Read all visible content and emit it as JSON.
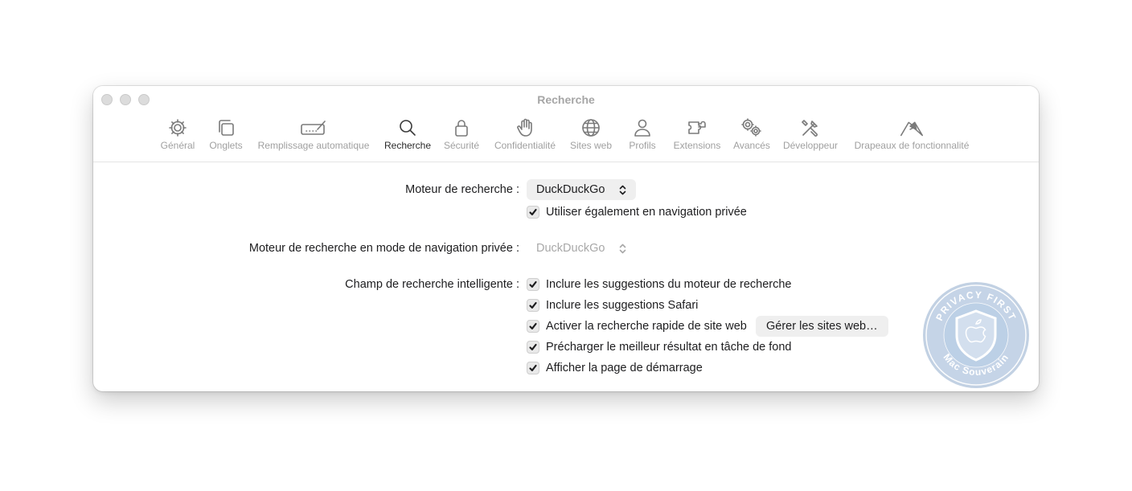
{
  "window": {
    "title": "Recherche"
  },
  "toolbar": {
    "items": [
      {
        "label": "Général",
        "icon": "gear-icon"
      },
      {
        "label": "Onglets",
        "icon": "tabs-icon"
      },
      {
        "label": "Remplissage automatique",
        "icon": "autofill-icon"
      },
      {
        "label": "Recherche",
        "icon": "search-icon",
        "active": true
      },
      {
        "label": "Sécurité",
        "icon": "lock-icon"
      },
      {
        "label": "Confidentialité",
        "icon": "hand-icon"
      },
      {
        "label": "Sites web",
        "icon": "globe-icon"
      },
      {
        "label": "Profils",
        "icon": "person-icon"
      },
      {
        "label": "Extensions",
        "icon": "puzzle-icon"
      },
      {
        "label": "Avancés",
        "icon": "gears-icon"
      },
      {
        "label": "Développeur",
        "icon": "tools-icon"
      },
      {
        "label": "Drapeaux de fonctionnalité",
        "icon": "flags-icon"
      }
    ]
  },
  "search": {
    "engine_label": "Moteur de recherche :",
    "engine_value": "DuckDuckGo",
    "private_also_label": "Utiliser également en navigation privée",
    "private_engine_label": "Moteur de recherche en mode de navigation privée :",
    "private_engine_value": "DuckDuckGo",
    "smart_field_label": "Champ de recherche intelligente :",
    "options": [
      {
        "label": "Inclure les suggestions du moteur de recherche",
        "checked": true
      },
      {
        "label": "Inclure les suggestions Safari",
        "checked": true
      },
      {
        "label": "Activer la recherche rapide de site web",
        "checked": true
      },
      {
        "label": "Précharger le meilleur résultat en tâche de fond",
        "checked": true
      },
      {
        "label": "Afficher la page de démarrage",
        "checked": true
      }
    ],
    "manage_sites_button": "Gérer les sites web…",
    "help": "?"
  },
  "badge": {
    "top_text": "PRIVACY FIRST",
    "bottom_text": "Mac Souverain",
    "colors": {
      "fill": "#c9d8ea",
      "ring": "#aec3dc",
      "text": "#ffffff"
    }
  }
}
